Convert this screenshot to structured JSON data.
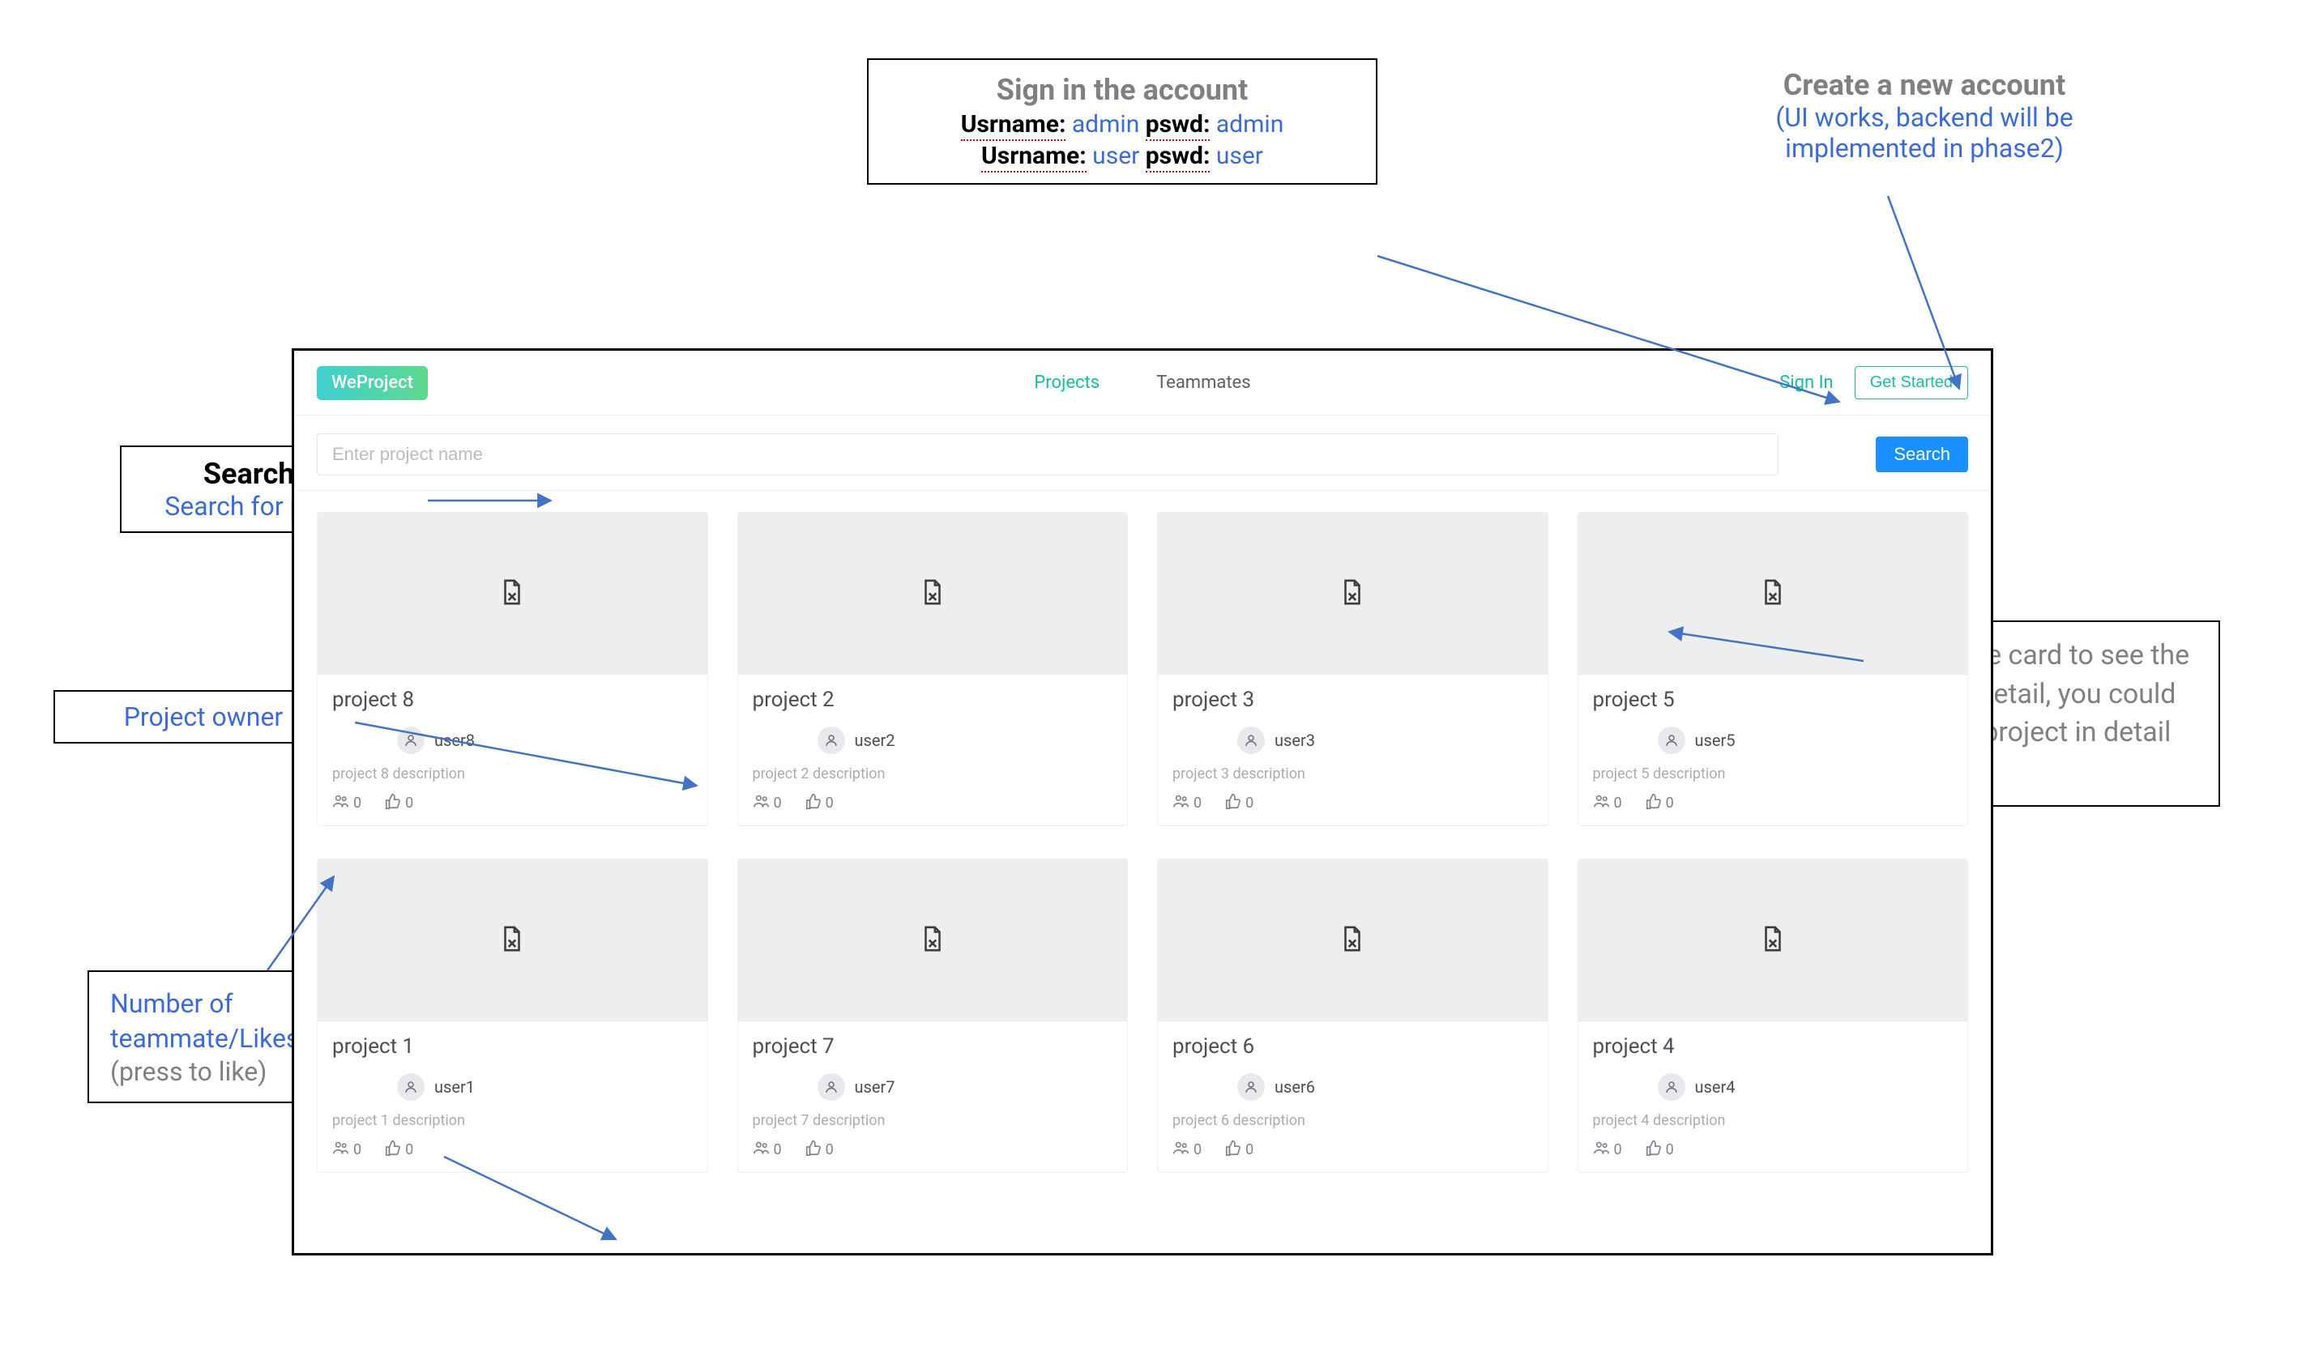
{
  "callouts": {
    "signin": {
      "title": "Sign in the account",
      "line1_label1": "Usrname:",
      "line1_val1": "admin",
      "line1_label2": "pswd:",
      "line1_val2": "admin",
      "line2_label1": "Usrname:",
      "line2_val1": "user",
      "line2_label2": "pswd:",
      "line2_val2": "user"
    },
    "create": {
      "title": "Create a new account",
      "sub": "(UI works, backend will be implemented in phase2)"
    },
    "searchbar": {
      "title": "Search bar",
      "sub": "Search for projects"
    },
    "owner": {
      "title": "Project owner"
    },
    "stats": {
      "line1": "Number of teammate/Likes",
      "line2": "(press to like)"
    },
    "card": {
      "text": "Press the card to see the project detail, you could join the project in detail page"
    }
  },
  "app": {
    "logo": "WeProject",
    "nav": {
      "projects": "Projects",
      "teammates": "Teammates"
    },
    "header": {
      "signin": "Sign In",
      "get_started": "Get Started"
    },
    "search": {
      "placeholder": "Enter project name",
      "button": "Search"
    },
    "projects": [
      {
        "title": "project 8",
        "owner": "user8",
        "desc": "project 8 description",
        "members": "0",
        "likes": "0"
      },
      {
        "title": "project 2",
        "owner": "user2",
        "desc": "project 2 description",
        "members": "0",
        "likes": "0"
      },
      {
        "title": "project 3",
        "owner": "user3",
        "desc": "project 3 description",
        "members": "0",
        "likes": "0"
      },
      {
        "title": "project 5",
        "owner": "user5",
        "desc": "project 5 description",
        "members": "0",
        "likes": "0"
      },
      {
        "title": "project 1",
        "owner": "user1",
        "desc": "project 1 description",
        "members": "0",
        "likes": "0"
      },
      {
        "title": "project 7",
        "owner": "user7",
        "desc": "project 7 description",
        "members": "0",
        "likes": "0"
      },
      {
        "title": "project 6",
        "owner": "user6",
        "desc": "project 6 description",
        "members": "0",
        "likes": "0"
      },
      {
        "title": "project 4",
        "owner": "user4",
        "desc": "project 4 description",
        "members": "0",
        "likes": "0"
      }
    ]
  },
  "colors": {
    "accent_teal": "#1abc9c",
    "accent_blue": "#1890ff",
    "callout_blue": "#3b6bd6"
  }
}
